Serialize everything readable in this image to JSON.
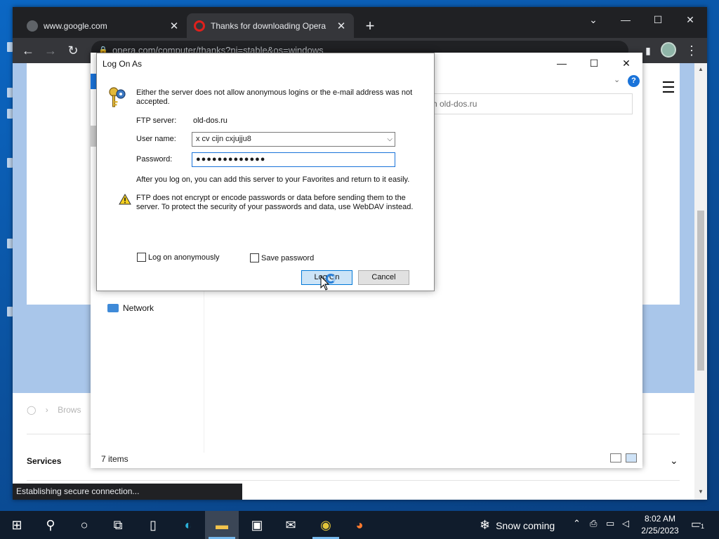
{
  "browser": {
    "tabs": [
      {
        "label": "www.google.com",
        "active": false
      },
      {
        "label": "Thanks for downloading Opera",
        "active": true
      }
    ],
    "new_tab": "+",
    "address": "opera.com/computer/thanks?ni=stable&os=windows",
    "status": "Establishing secure connection...",
    "page": {
      "breadcrumb": "Brows",
      "services_label": "Services"
    }
  },
  "explorer": {
    "search_placeholder": "rch old-dos.ru",
    "network_label": "Network",
    "status_count": "7 items"
  },
  "dialog": {
    "title": "Log On As",
    "message": "Either the server does not allow anonymous logins or the e-mail address was not accepted.",
    "ftp_server_label": "FTP server:",
    "ftp_server_value": "old-dos.ru",
    "username_label": "User name:",
    "username_value": "x cv cijn cxjujju8",
    "password_label": "Password:",
    "password_value": "●●●●●●●●●●●●●",
    "info_text": "After you log on, you can add this server to your Favorites and return to it easily.",
    "warning_text": "FTP does not encrypt or encode passwords or data before sending them to the server.  To protect the security of your passwords and data, use WebDAV instead.",
    "anon_label": "Log on anonymously",
    "anon_checked": false,
    "save_label": "Save password",
    "save_checked": false,
    "logon_button": "Log On",
    "cancel_button": "Cancel"
  },
  "taskbar": {
    "weather": "Snow coming",
    "time": "8:02 AM",
    "date": "2/25/2023",
    "notification_count": "1"
  },
  "colors": {
    "desktop": "#0b67c4",
    "chrome_dark": "#202124",
    "accent": "#0078d7",
    "page_banner": "#a9c6ea"
  }
}
